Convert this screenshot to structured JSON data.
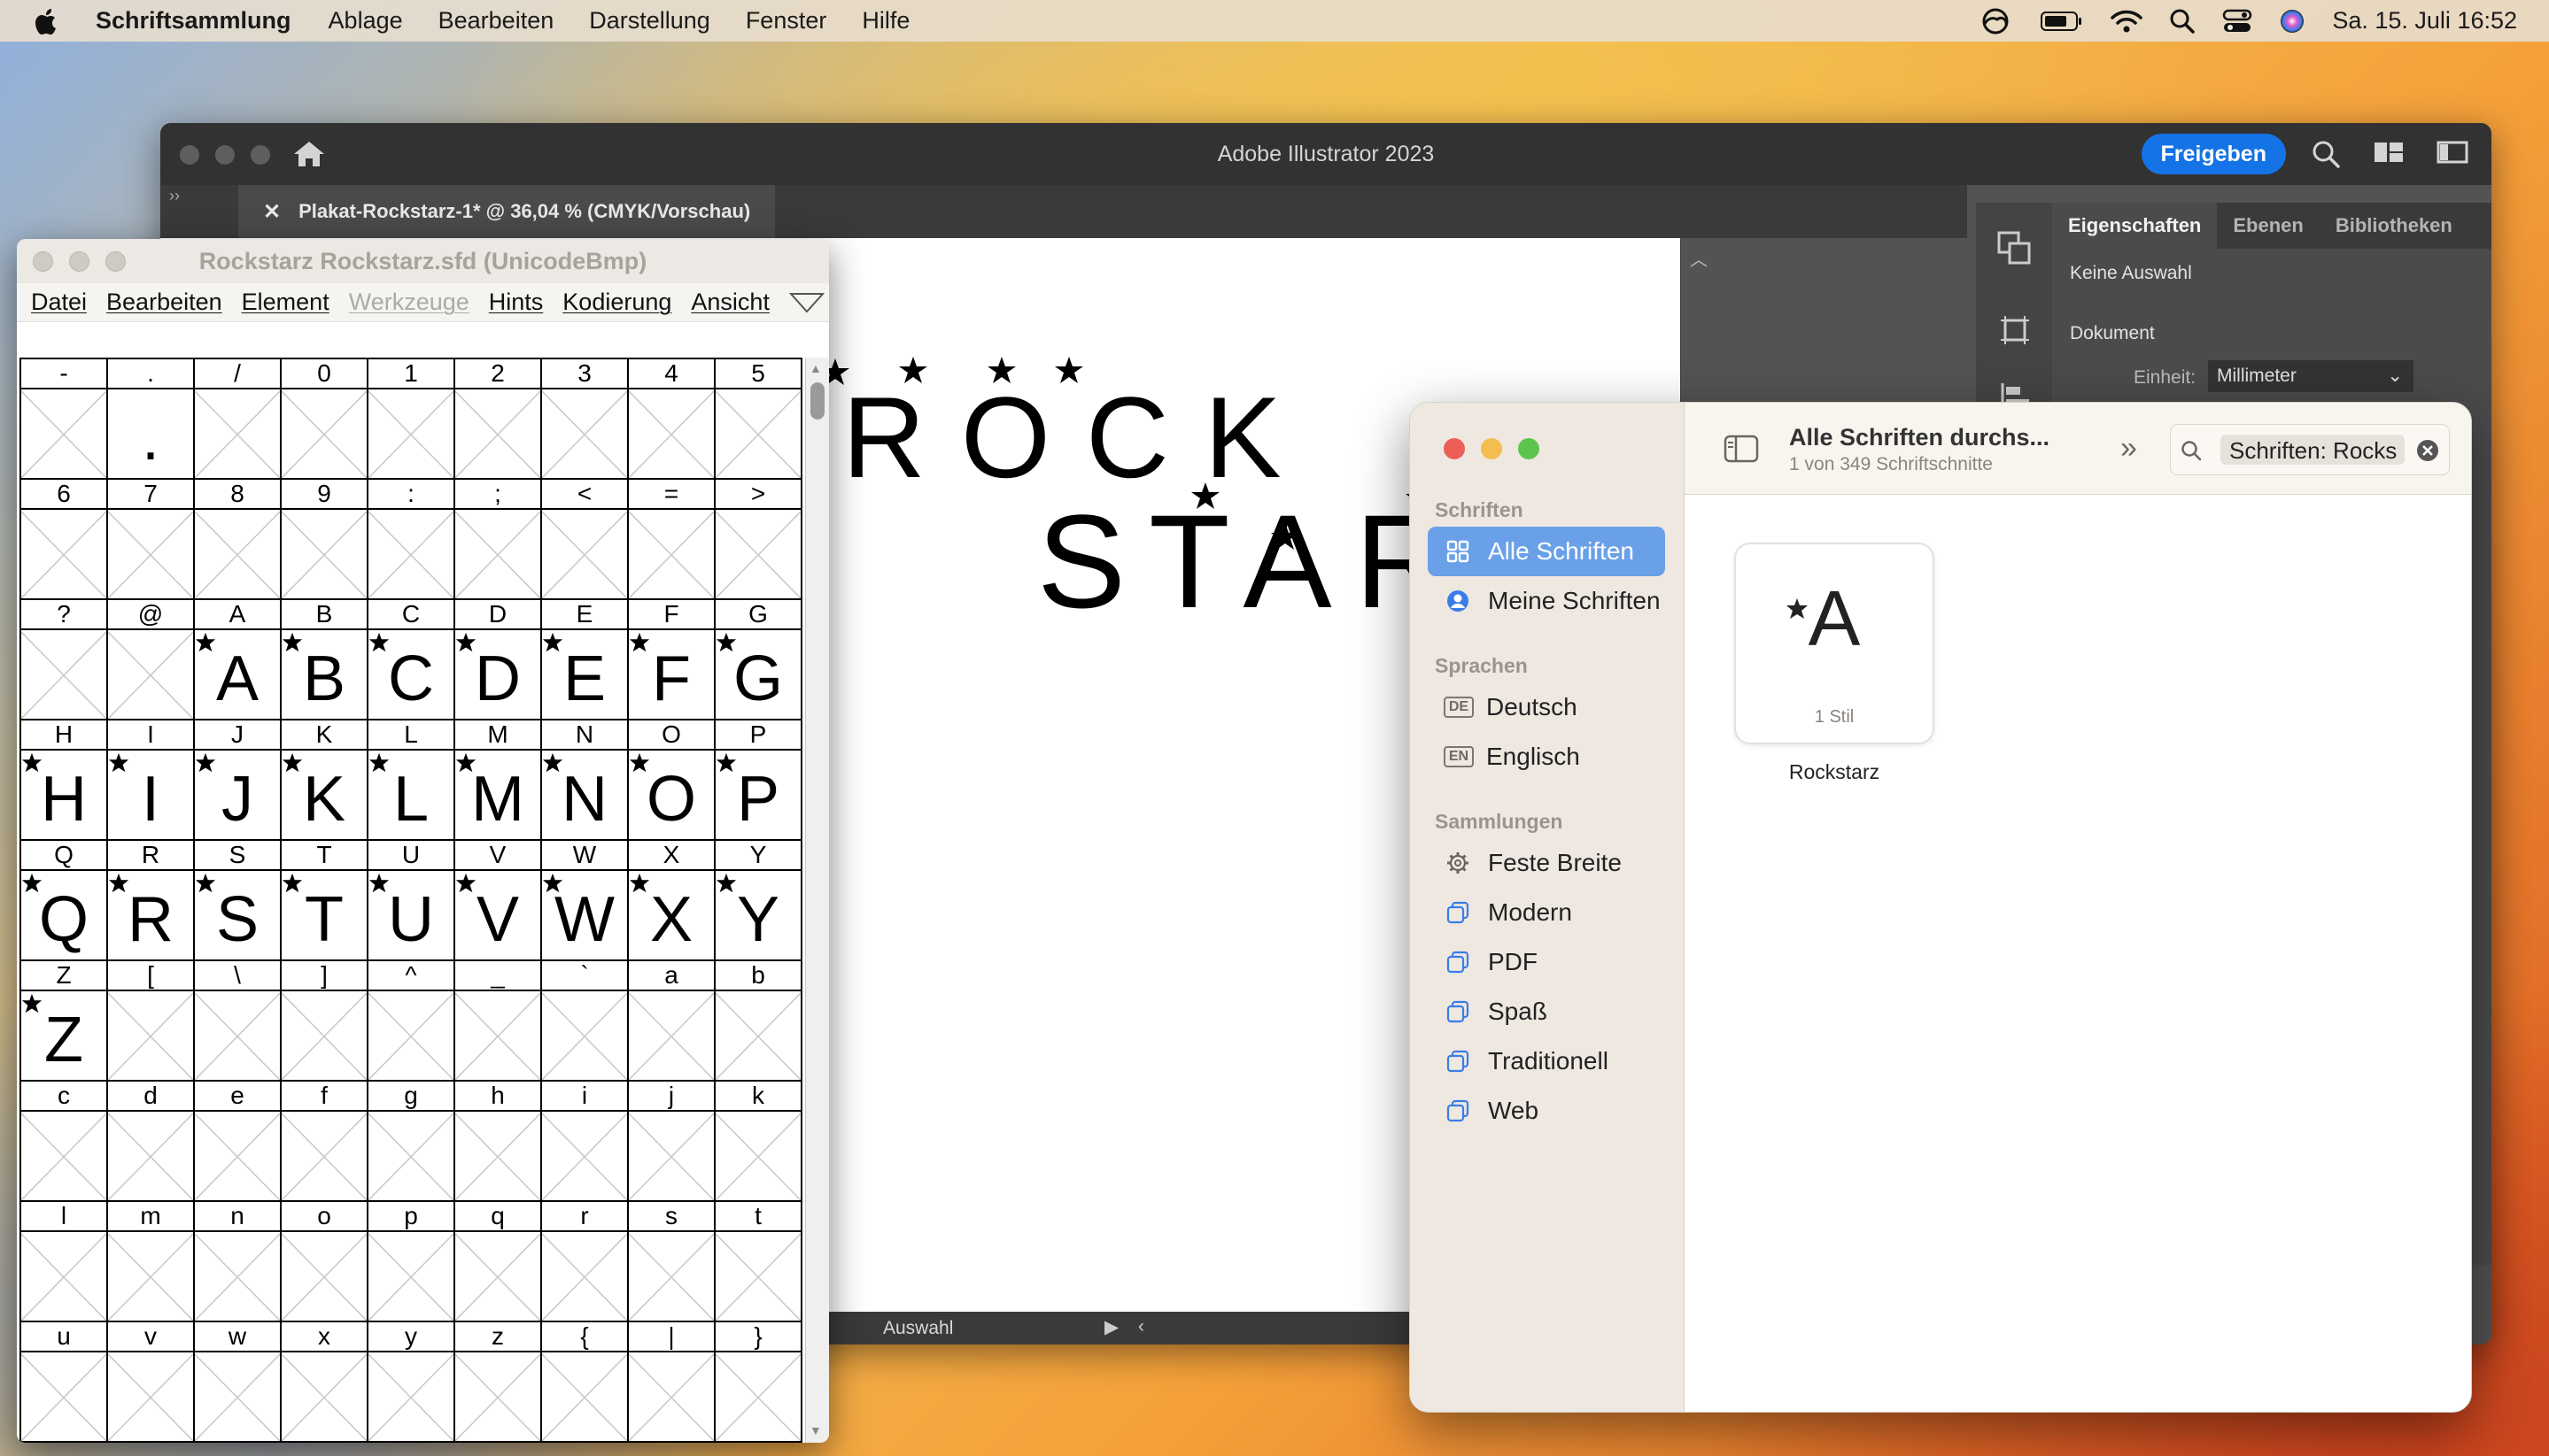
{
  "menubar": {
    "app_name": "Schriftsammlung",
    "items": [
      "Ablage",
      "Bearbeiten",
      "Darstellung",
      "Fenster",
      "Hilfe"
    ],
    "clock": "Sa. 15. Juli  16:52"
  },
  "illustrator": {
    "window_title": "Adobe Illustrator 2023",
    "share_label": "Freigeben",
    "doc_tab": "Plakat-Rockstarz-1* @ 36,04 % (CMYK/Vorschau)",
    "artwork_line1": "ROCK",
    "artwork_line2": "STAR",
    "status_tool": "Auswahl",
    "panel_tabs": [
      "Eigenschaften",
      "Ebenen",
      "Bibliotheken"
    ],
    "no_selection": "Keine Auswahl",
    "document_label": "Dokument",
    "unit_label": "Einheit:",
    "unit_value": "Millimeter"
  },
  "fontforge": {
    "title": "Rockstarz  Rockstarz.sfd (UnicodeBmp)",
    "menu": [
      "Datei",
      "Bearbeiten",
      "Element",
      "Werkzeuge",
      "Hints",
      "Kodierung",
      "Ansicht"
    ],
    "disabled_menu": "Werkzeuge",
    "glyph_rows": [
      [
        {
          "l": "-",
          "g": ""
        },
        {
          "l": ".",
          "g": "."
        },
        {
          "l": "/",
          "g": ""
        },
        {
          "l": "0",
          "g": ""
        },
        {
          "l": "1",
          "g": ""
        },
        {
          "l": "2",
          "g": ""
        },
        {
          "l": "3",
          "g": ""
        },
        {
          "l": "4",
          "g": ""
        },
        {
          "l": "5",
          "g": ""
        }
      ],
      [
        {
          "l": "6",
          "g": ""
        },
        {
          "l": "7",
          "g": ""
        },
        {
          "l": "8",
          "g": ""
        },
        {
          "l": "9",
          "g": ""
        },
        {
          "l": ":",
          "g": ""
        },
        {
          "l": ";",
          "g": ""
        },
        {
          "l": "<",
          "g": ""
        },
        {
          "l": "=",
          "g": ""
        },
        {
          "l": ">",
          "g": ""
        }
      ],
      [
        {
          "l": "?",
          "g": ""
        },
        {
          "l": "@",
          "g": ""
        },
        {
          "l": "A",
          "g": "A"
        },
        {
          "l": "B",
          "g": "B"
        },
        {
          "l": "C",
          "g": "C"
        },
        {
          "l": "D",
          "g": "D"
        },
        {
          "l": "E",
          "g": "E"
        },
        {
          "l": "F",
          "g": "F"
        },
        {
          "l": "G",
          "g": "G"
        }
      ],
      [
        {
          "l": "H",
          "g": "H"
        },
        {
          "l": "I",
          "g": "I"
        },
        {
          "l": "J",
          "g": "J"
        },
        {
          "l": "K",
          "g": "K"
        },
        {
          "l": "L",
          "g": "L"
        },
        {
          "l": "M",
          "g": "M"
        },
        {
          "l": "N",
          "g": "N"
        },
        {
          "l": "O",
          "g": "O"
        },
        {
          "l": "P",
          "g": "P"
        }
      ],
      [
        {
          "l": "Q",
          "g": "Q"
        },
        {
          "l": "R",
          "g": "R"
        },
        {
          "l": "S",
          "g": "S"
        },
        {
          "l": "T",
          "g": "T"
        },
        {
          "l": "U",
          "g": "U"
        },
        {
          "l": "V",
          "g": "V"
        },
        {
          "l": "W",
          "g": "W"
        },
        {
          "l": "X",
          "g": "X"
        },
        {
          "l": "Y",
          "g": "Y"
        }
      ],
      [
        {
          "l": "Z",
          "g": "Z"
        },
        {
          "l": "[",
          "g": ""
        },
        {
          "l": "\\",
          "g": ""
        },
        {
          "l": "]",
          "g": ""
        },
        {
          "l": "^",
          "g": ""
        },
        {
          "l": "_",
          "g": ""
        },
        {
          "l": "`",
          "g": ""
        },
        {
          "l": "a",
          "g": ""
        },
        {
          "l": "b",
          "g": ""
        }
      ],
      [
        {
          "l": "c",
          "g": ""
        },
        {
          "l": "d",
          "g": ""
        },
        {
          "l": "e",
          "g": ""
        },
        {
          "l": "f",
          "g": ""
        },
        {
          "l": "g",
          "g": ""
        },
        {
          "l": "h",
          "g": ""
        },
        {
          "l": "i",
          "g": ""
        },
        {
          "l": "j",
          "g": ""
        },
        {
          "l": "k",
          "g": ""
        }
      ],
      [
        {
          "l": "l",
          "g": ""
        },
        {
          "l": "m",
          "g": ""
        },
        {
          "l": "n",
          "g": ""
        },
        {
          "l": "o",
          "g": ""
        },
        {
          "l": "p",
          "g": ""
        },
        {
          "l": "q",
          "g": ""
        },
        {
          "l": "r",
          "g": ""
        },
        {
          "l": "s",
          "g": ""
        },
        {
          "l": "t",
          "g": ""
        }
      ],
      [
        {
          "l": "u",
          "g": ""
        },
        {
          "l": "v",
          "g": ""
        },
        {
          "l": "w",
          "g": ""
        },
        {
          "l": "x",
          "g": ""
        },
        {
          "l": "y",
          "g": ""
        },
        {
          "l": "z",
          "g": ""
        },
        {
          "l": "{",
          "g": ""
        },
        {
          "l": "|",
          "g": ""
        },
        {
          "l": "}",
          "g": ""
        }
      ]
    ]
  },
  "fontbook": {
    "header_title": "Alle Schriften durchs...",
    "header_sub": "1 von 349 Schriftschnitte",
    "search_value": "Schriften: Rocks",
    "sec_fonts": "Schriften",
    "all_fonts": "Alle Schriften",
    "my_fonts": "Meine Schriften",
    "sec_languages": "Sprachen",
    "languages": [
      {
        "code": "DE",
        "name": "Deutsch"
      },
      {
        "code": "EN",
        "name": "Englisch"
      }
    ],
    "sec_collections": "Sammlungen",
    "fixed_width": "Feste Breite",
    "collections": [
      "Modern",
      "PDF",
      "Spaß",
      "Traditionell",
      "Web"
    ],
    "card_glyph": "A",
    "card_styles": "1 Stil",
    "card_name": "Rockstarz"
  }
}
